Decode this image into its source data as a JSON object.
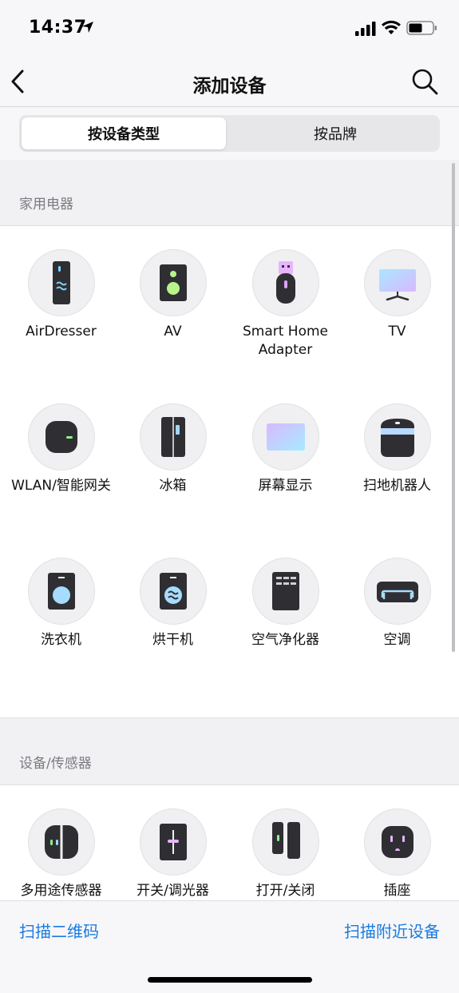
{
  "status_bar": {
    "time": "14:37"
  },
  "nav": {
    "title": "添加设备"
  },
  "segments": {
    "by_type": "按设备类型",
    "by_brand": "按品牌"
  },
  "sections": [
    {
      "title": "家用电器",
      "items": [
        {
          "label": "AirDresser",
          "icon": "airdresser-icon"
        },
        {
          "label": "AV",
          "icon": "speaker-icon"
        },
        {
          "label": "Smart Home Adapter",
          "icon": "usb-adapter-icon"
        },
        {
          "label": "TV",
          "icon": "tv-icon"
        },
        {
          "label": "WLAN/智能网关",
          "icon": "hub-icon"
        },
        {
          "label": "冰箱",
          "icon": "fridge-icon"
        },
        {
          "label": "屏幕显示",
          "icon": "display-icon"
        },
        {
          "label": "扫地机器人",
          "icon": "robot-vacuum-icon"
        },
        {
          "label": "洗衣机",
          "icon": "washer-icon"
        },
        {
          "label": "烘干机",
          "icon": "dryer-icon"
        },
        {
          "label": "空气净化器",
          "icon": "air-purifier-icon"
        },
        {
          "label": "空调",
          "icon": "air-conditioner-icon"
        }
      ]
    },
    {
      "title": "设备/传感器",
      "items": [
        {
          "label": "多用途传感器",
          "icon": "multipurpose-sensor-icon"
        },
        {
          "label": "开关/调光器",
          "icon": "switch-dimmer-icon"
        },
        {
          "label": "打开/关闭",
          "icon": "open-close-sensor-icon"
        },
        {
          "label": "插座",
          "icon": "outlet-icon"
        }
      ]
    }
  ],
  "bottom": {
    "scan_qr": "扫描二维码",
    "scan_nearby": "扫描附近设备"
  },
  "colors": {
    "accent": "#1a7ce0",
    "device_dark": "#2f2f33",
    "header_bg": "#f1f1f4"
  }
}
